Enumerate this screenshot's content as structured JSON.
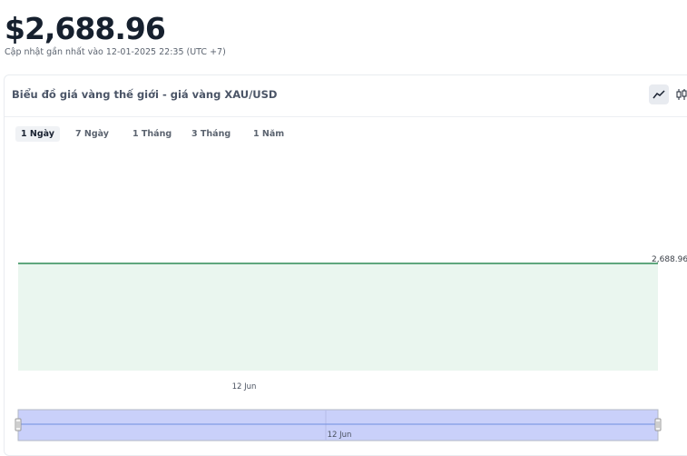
{
  "header": {
    "price": "$2,688.96",
    "updated": "Cập nhật gần nhất vào 12-01-2025 22:35 (UTC +7)"
  },
  "card": {
    "title": "Biểu đồ giá vàng thế giới - giá vàng XAU/USD",
    "chart_type_buttons": [
      {
        "name": "line-chart-icon",
        "active": true
      },
      {
        "name": "candlestick-chart-icon",
        "active": false
      }
    ],
    "tabs": [
      {
        "label": "1 Ngày",
        "active": true
      },
      {
        "label": "7 Ngày",
        "active": false
      },
      {
        "label": "1 Tháng",
        "active": false
      },
      {
        "label": "3 Tháng",
        "active": false
      },
      {
        "label": "1 Năm",
        "active": false
      }
    ]
  },
  "colors": {
    "line": "#2e8b57",
    "area": "#eaf6ef",
    "navigator_fill": "#c9d0fa",
    "navigator_line": "#6f8ee0"
  },
  "chart_data": {
    "type": "area",
    "series": [
      {
        "values": [
          2688.96,
          2688.96
        ]
      }
    ],
    "last_value_label": "2,688.96",
    "x_tick_labels": [
      "12 Jun"
    ],
    "navigator_label": "12 Jun"
  }
}
